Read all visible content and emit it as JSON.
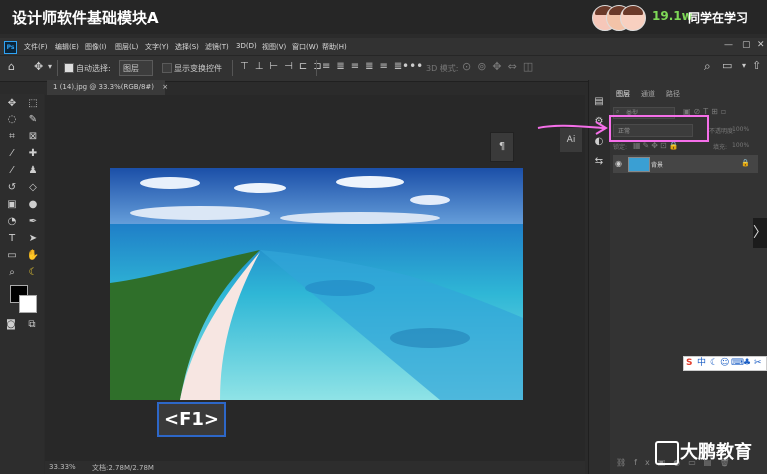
{
  "course": {
    "title": "设计师软件基础模块A",
    "learners_count": "19.1w",
    "learners_label": "同学在学习"
  },
  "menubar": {
    "logo": "Ps",
    "items": [
      "文件(F)",
      "编辑(E)",
      "图像(I)",
      "图层(L)",
      "文字(Y)",
      "选择(S)",
      "滤镜(T)",
      "3D(D)",
      "视图(V)",
      "窗口(W)",
      "帮助(H)"
    ]
  },
  "options": {
    "auto_select_label": "自动选择:",
    "auto_select_value": "图层",
    "show_transform_label": "显示变换控件",
    "mode_3d_label": "3D 模式:"
  },
  "document": {
    "tab_title": "1 (14).jpg @ 33.3%(RGB/8#)",
    "close_glyph": "×"
  },
  "panels": {
    "tabs": [
      "图层",
      "通道",
      "路径"
    ],
    "search_placeholder": "类型",
    "blend_mode": "正常",
    "opacity_label": "不透明度:",
    "opacity_value": "100%",
    "lock_label": "锁定:",
    "fill_label": "填充:",
    "fill_value": "100%",
    "layer_name": "背景"
  },
  "overlay": {
    "key_hint": "<F1>"
  },
  "status": {
    "zoom": "33.33%",
    "doc_info": "文档:2.78M/2.78M"
  },
  "ime": {
    "label": "中"
  },
  "brand": {
    "name": "大鹏教育"
  },
  "colors": {
    "highlight_pink": "#f56fe9",
    "key_hint_border": "#2d67c8",
    "learners_green": "#7ed957"
  }
}
